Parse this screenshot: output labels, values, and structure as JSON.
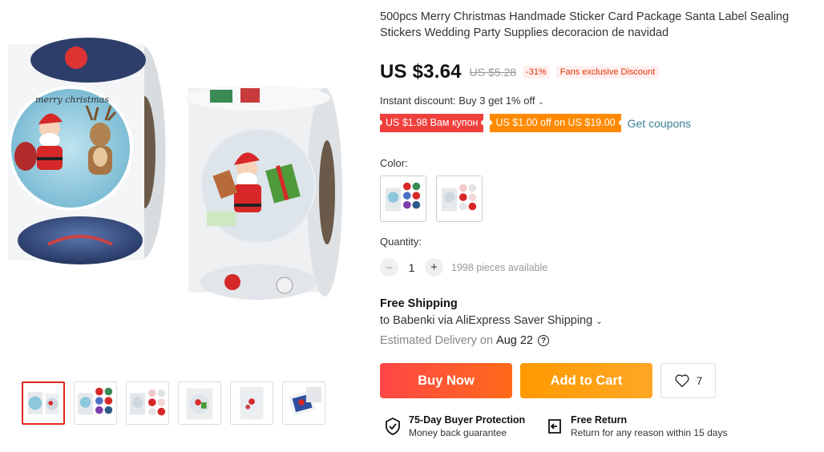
{
  "product": {
    "title": "500pcs Merry Christmas Handmade Sticker Card Package Santa Label Sealing Stickers Wedding Party Supplies decoracion de navidad",
    "main_image_text": "merry christmas"
  },
  "price": {
    "current": "US $3.64",
    "original": "US $5.28",
    "discount": "-31%",
    "fans_badge": "Fans exclusive Discount"
  },
  "promo": {
    "instant_discount": "Instant discount: Buy 3 get 1% off",
    "coupons": [
      "US $1.98 Вам купон",
      "US $1.00 off on US $19.00"
    ],
    "get_coupons": "Get coupons"
  },
  "color": {
    "label": "Color:",
    "options": [
      "sticker-roll-variant-1",
      "sticker-roll-variant-2"
    ]
  },
  "quantity": {
    "label": "Quantity:",
    "value": "1",
    "available": "1998 pieces available"
  },
  "shipping": {
    "title": "Free Shipping",
    "line": "to Babenki via AliExpress Saver Shipping",
    "eta_label": "Estimated Delivery on",
    "eta_date": "Aug 22"
  },
  "actions": {
    "buy_now": "Buy Now",
    "add_to_cart": "Add to Cart",
    "wishlist_count": "7"
  },
  "guarantees": [
    {
      "title": "75-Day Buyer Protection",
      "sub": "Money back guarantee"
    },
    {
      "title": "Free Return",
      "sub": "Return for any reason within 15 days"
    }
  ],
  "colors": {
    "accent_red": "#e0261c",
    "buy_gradient_start": "#ff4747",
    "cart_orange": "#ff9a00",
    "coupon_red": "#f0403c",
    "coupon_orange": "#ff8a00",
    "link_teal": "#3a7d94"
  }
}
